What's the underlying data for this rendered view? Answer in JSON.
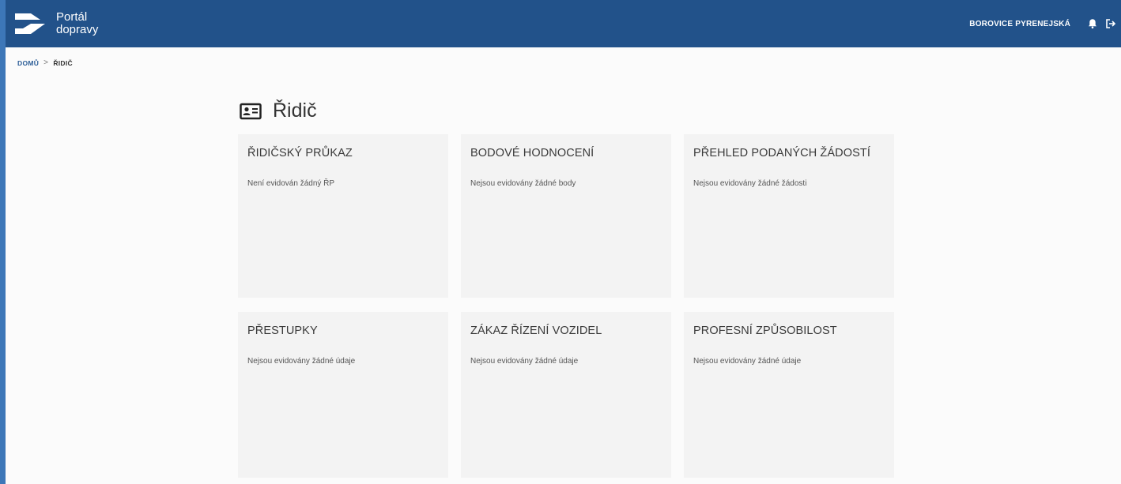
{
  "header": {
    "logo_line1": "Portál",
    "logo_line2": "dopravy",
    "user_name": "BOROVICE PYRENEJSKÁ",
    "bg_color": "#22528a"
  },
  "icons": {
    "logo": "arrow-logo-icon",
    "notifications": "bell-icon",
    "logout": "logout-icon",
    "title": "id-card-icon"
  },
  "breadcrumb": {
    "home": "DOMŮ",
    "separator": ">",
    "current": "ŘIDIČ"
  },
  "page": {
    "title": "Řidič"
  },
  "cards": [
    {
      "title": "ŘIDIČSKÝ PRŮKAZ",
      "text": "Není evidován žádný ŘP"
    },
    {
      "title": "BODOVÉ HODNOCENÍ",
      "text": "Nejsou evidovány žádné body"
    },
    {
      "title": "PŘEHLED PODANÝCH ŽÁDOSTÍ",
      "text": "Nejsou evidovány žádné žádosti"
    },
    {
      "title": "PŘESTUPKY",
      "text": "Nejsou evidovány žádné údaje"
    },
    {
      "title": "ZÁKAZ ŘÍZENÍ VOZIDEL",
      "text": "Nejsou evidovány žádné údaje"
    },
    {
      "title": "PROFESNÍ ZPŮSOBILOST",
      "text": "Nejsou evidovány žádné údaje"
    }
  ]
}
